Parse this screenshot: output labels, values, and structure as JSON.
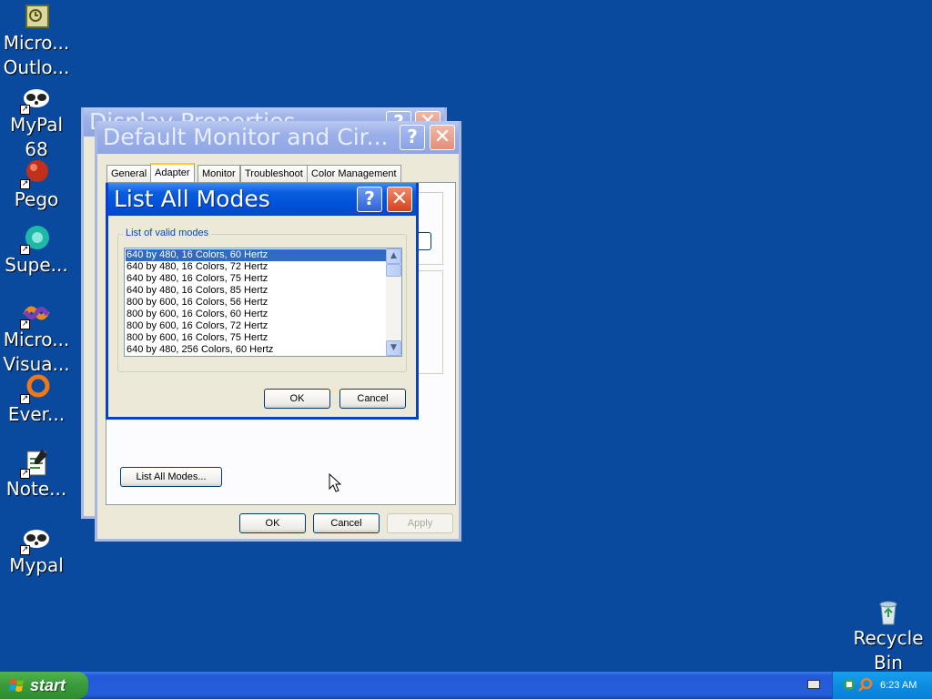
{
  "desktop": {
    "icons": [
      {
        "name": "Micro...\nOutlo...",
        "icon": "outlook-icon"
      },
      {
        "name": "MyPal\n68",
        "icon": "mypal-icon"
      },
      {
        "name": "Pego",
        "icon": "pego-icon"
      },
      {
        "name": "Supe...",
        "icon": "supermium-icon"
      },
      {
        "name": "Micro...\nVisua...",
        "icon": "visual-studio-icon"
      },
      {
        "name": "Ever...",
        "icon": "everything-icon"
      },
      {
        "name": "Note...",
        "icon": "notepad-icon"
      },
      {
        "name": "Mypal",
        "icon": "mypal-icon"
      },
      {
        "name": "Recycle\nBin",
        "icon": "recycle-bin-icon"
      }
    ]
  },
  "display_properties": {
    "title": "Display Properties"
  },
  "monitor_dialog": {
    "title": "Default Monitor and Cir...",
    "tabs": [
      "General",
      "Adapter",
      "Monitor",
      "Troubleshoot",
      "Color Management"
    ],
    "selected_tab": "Adapter",
    "list_all_modes_button": "List All Modes...",
    "ok": "OK",
    "cancel": "Cancel",
    "apply": "Apply"
  },
  "modes_dialog": {
    "title": "List All Modes",
    "group_label": "List of valid modes",
    "modes": [
      "640 by 480, 16 Colors, 60 Hertz",
      "640 by 480, 16 Colors, 72 Hertz",
      "640 by 480, 16 Colors, 75 Hertz",
      "640 by 480, 16 Colors, 85 Hertz",
      "800 by 600, 16 Colors, 56 Hertz",
      "800 by 600, 16 Colors, 60 Hertz",
      "800 by 600, 16 Colors, 72 Hertz",
      "800 by 600, 16 Colors, 75 Hertz",
      "640 by 480, 256 Colors, 60 Hertz"
    ],
    "selected_index": 0,
    "ok": "OK",
    "cancel": "Cancel"
  },
  "taskbar": {
    "start_label": "start",
    "clock": "6:23 AM"
  },
  "colors": {
    "desktop": "#0a4a9e",
    "title_active": "#0050d8",
    "selection": "#316ac5"
  }
}
